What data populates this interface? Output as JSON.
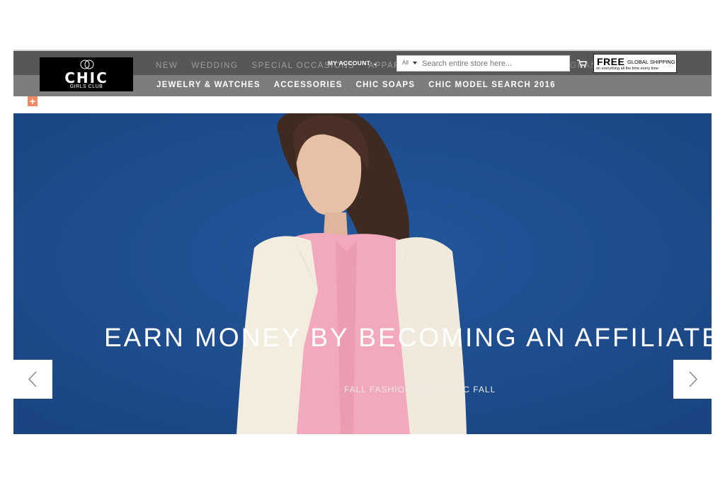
{
  "logo": {
    "brand": "CHIC",
    "sub": "GIRLS CLUB"
  },
  "nav_primary": [
    "NEW",
    "WEDDING",
    "SPECIAL OCCASIONS",
    "APPAREL"
  ],
  "nav_secondary": [
    "JEWELRY & WATCHES",
    "ACCESSORIES",
    "CHIC SOAPS",
    "CHIC MODEL SEARCH 2016"
  ],
  "account": {
    "label": "MY ACCOUNT"
  },
  "search": {
    "category": "All",
    "placeholder": "Search entire store here..."
  },
  "nav_overflow": "GRAN",
  "shipping": {
    "free": "FREE",
    "label": "GLOBAL SHIPPING",
    "small": "on everything all the time every time"
  },
  "hero": {
    "headline": "EARN MONEY BY BECOMING AN AFFILIATE",
    "subline": "FALL FASHION FOR A CHIC FALL"
  },
  "colors": {
    "header": "#7d7d7d",
    "topbar": "#575757",
    "hero_bg": "#1f4e8f",
    "plus_accent": "#f08b63"
  }
}
